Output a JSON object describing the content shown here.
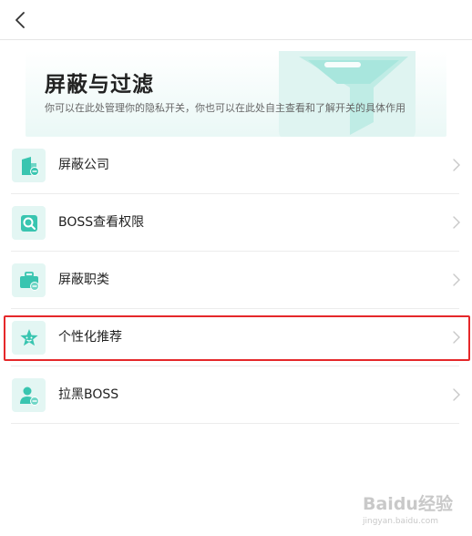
{
  "colors": {
    "accent": "#39c5b0",
    "icon_bg": "#e3f6f3",
    "highlight": "#e5282a"
  },
  "header": {
    "back_icon": "chevron-left-icon"
  },
  "hero": {
    "title": "屏蔽与过滤",
    "description": "你可以在此处管理你的隐私开关，你也可以在此处自主查看和了解开关的具体作用",
    "decoration_icon": "funnel-icon"
  },
  "menu": {
    "items": [
      {
        "label": "屏蔽公司",
        "icon": "building-block-icon"
      },
      {
        "label": "BOSS查看权限",
        "icon": "view-permission-icon"
      },
      {
        "label": "屏蔽职类",
        "icon": "briefcase-block-icon"
      },
      {
        "label": "个性化推荐",
        "icon": "star-icon"
      },
      {
        "label": "拉黑BOSS",
        "icon": "user-block-icon"
      }
    ]
  },
  "watermark": {
    "main": "Baidu经验",
    "sub": "jingyan.baidu.com"
  }
}
